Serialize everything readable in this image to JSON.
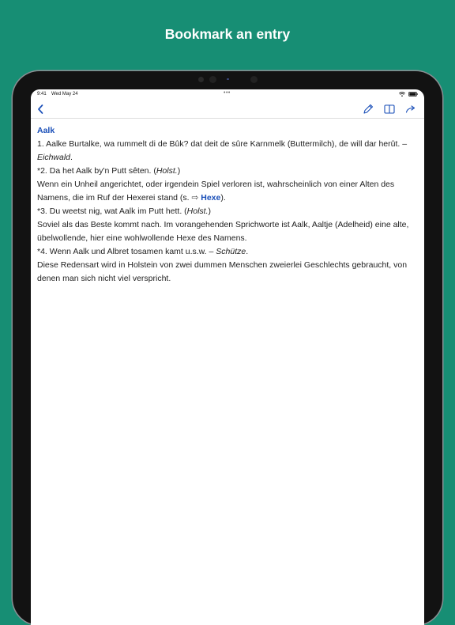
{
  "promo": {
    "title": "Bookmark an entry"
  },
  "status_bar": {
    "time": "9:41",
    "date": "Wed May 24"
  },
  "nav": {
    "back_icon": "chevron-left-icon",
    "edit_icon": "pencil-icon",
    "book_icon": "book-icon",
    "share_icon": "share-arrow-icon"
  },
  "colors": {
    "background": "#178e74",
    "accent": "#1a4fb8",
    "text": "#1e1e1e"
  },
  "entry": {
    "headword": "Aalk",
    "s1_text": "1. Aalke Burtalke, wa rummelt di de Bûk? dat deit de sûre Karnmelk (Buttermilch), de will dar herût. –",
    "s1_source": "Eichwald",
    "s1_end": ".",
    "s2_text": "*2. Da het Aalk by'n Putt sêten. (",
    "s2_source": "Holst.",
    "s2_end": ")",
    "s2_note_pre": "Wenn ein Unheil angerichtet, oder irgendein Spiel verloren ist, wahrscheinlich von einer Alten des Namens, die im Ruf der Hexerei stand (s.",
    "s2_note_arrow": "⇨",
    "s2_note_link": "Hexe",
    "s2_note_post": ").",
    "s3_text": "*3. Du weetst nig, wat Aalk im Putt hett. (",
    "s3_source": "Holst.",
    "s3_end": ")",
    "s3_note": "Soviel als das Beste kommt nach. Im vorangehenden Sprichworte ist Aalk, Aaltje (Adelheid) eine alte, übelwollende, hier eine wohlwollende Hexe des Namens.",
    "s4_text": "*4. Wenn Aalk und Albret tosamen kamt u.s.w. –",
    "s4_source": "Schütze",
    "s4_end": ".",
    "s4_note": "Diese Redensart wird in Holstein von zwei dummen Menschen zweierlei Geschlechts gebraucht, von denen man sich nicht viel verspricht."
  }
}
